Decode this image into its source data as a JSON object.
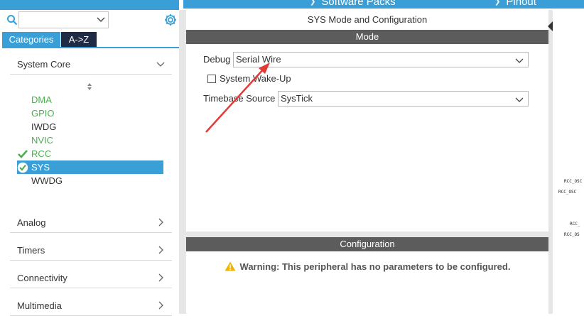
{
  "topbar": {
    "items": [
      {
        "label": "Software Packs"
      },
      {
        "label": "Pinout"
      }
    ]
  },
  "sidebar": {
    "search": {
      "value": "",
      "placeholder": ""
    },
    "tabs": [
      {
        "label": "Categories",
        "active": true
      },
      {
        "label": "A->Z",
        "active": false
      }
    ],
    "categories": [
      {
        "label": "System Core",
        "expanded": true
      },
      {
        "label": "Analog",
        "expanded": false
      },
      {
        "label": "Timers",
        "expanded": false
      },
      {
        "label": "Connectivity",
        "expanded": false
      },
      {
        "label": "Multimedia",
        "expanded": false
      }
    ],
    "system_core_items": [
      {
        "label": "DMA",
        "state": "green"
      },
      {
        "label": "GPIO",
        "state": "green"
      },
      {
        "label": "IWDG",
        "state": "plain"
      },
      {
        "label": "NVIC",
        "state": "green"
      },
      {
        "label": "RCC",
        "state": "checked"
      },
      {
        "label": "SYS",
        "state": "selected"
      },
      {
        "label": "WWDG",
        "state": "plain"
      }
    ]
  },
  "main": {
    "title": "SYS Mode and Configuration",
    "mode_section": "Mode",
    "debug_label": "Debug",
    "debug_value": "Serial Wire",
    "wake_label": "System Wake-Up",
    "wake_checked": false,
    "timebase_label": "Timebase Source",
    "timebase_value": "SysTick",
    "config_section": "Configuration",
    "warning_text": "Warning: This peripheral has no parameters to be configured."
  },
  "pinout": {
    "labels": [
      "RCC_OSC",
      "RCC_OSC",
      "RCC_",
      "RCC_OS"
    ]
  },
  "colors": {
    "accent": "#3a9fd6",
    "dark_tab": "#1f2a44",
    "section_bar": "#5c5c5c",
    "green": "#4caf50",
    "warning": "#f0b400",
    "annotation_arrow": "#e53935"
  }
}
